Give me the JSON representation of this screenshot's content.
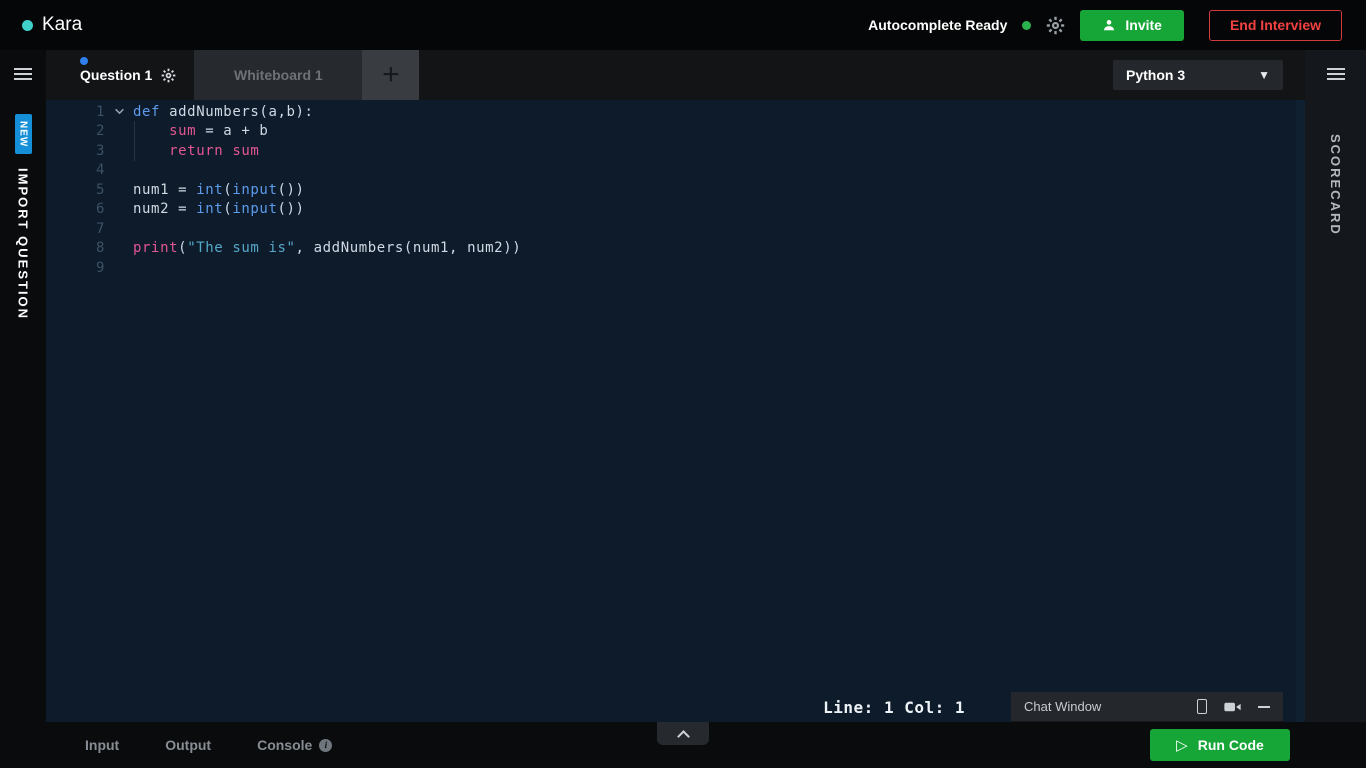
{
  "topbar": {
    "logo": "Kara",
    "autocomplete_status": "Autocomplete Ready",
    "invite_label": "Invite",
    "end_interview_label": "End Interview"
  },
  "left_rail": {
    "new_badge": "NEW",
    "import_question_label": "IMPORT QUESTION"
  },
  "right_rail": {
    "scorecard_label": "SCORECARD"
  },
  "tabbar": {
    "question_tab_label": "Question 1",
    "whiteboard_tab_label": "Whiteboard 1",
    "add_tab_label": "+",
    "language_selected": "Python 3"
  },
  "editor": {
    "status_line": "Line: 1 Col: 1",
    "code_lines": [
      {
        "num": "1",
        "fold": true,
        "tokens": [
          [
            "k",
            "def"
          ],
          [
            "t",
            " addNumbers(a,b):"
          ]
        ]
      },
      {
        "num": "2",
        "guide": true,
        "tokens": [
          [
            "t",
            "    "
          ],
          [
            "p",
            "sum"
          ],
          [
            "t",
            " = a + b"
          ]
        ]
      },
      {
        "num": "3",
        "guide": true,
        "tokens": [
          [
            "t",
            "    "
          ],
          [
            "p",
            "return"
          ],
          [
            "t",
            " "
          ],
          [
            "p",
            "sum"
          ]
        ]
      },
      {
        "num": "4",
        "tokens": []
      },
      {
        "num": "5",
        "tokens": [
          [
            "t",
            "num1 = "
          ],
          [
            "k",
            "int"
          ],
          [
            "t",
            "("
          ],
          [
            "k",
            "input"
          ],
          [
            "t",
            "())"
          ]
        ]
      },
      {
        "num": "6",
        "tokens": [
          [
            "t",
            "num2 = "
          ],
          [
            "k",
            "int"
          ],
          [
            "t",
            "("
          ],
          [
            "k",
            "input"
          ],
          [
            "t",
            "())"
          ]
        ]
      },
      {
        "num": "7",
        "tokens": []
      },
      {
        "num": "8",
        "tokens": [
          [
            "p",
            "print"
          ],
          [
            "t",
            "("
          ],
          [
            "s",
            "\"The sum is\""
          ],
          [
            "t",
            ", addNumbers(num1, num2))"
          ]
        ]
      },
      {
        "num": "9",
        "tokens": []
      }
    ]
  },
  "chat": {
    "title": "Chat Window"
  },
  "bottombar": {
    "input_label": "Input",
    "output_label": "Output",
    "console_label": "Console",
    "run_code_label": "Run Code"
  },
  "colors": {
    "brand_teal": "#3fd0c9",
    "action_green": "#16a637",
    "danger_red": "#e03131",
    "badge_blue": "#1590d8",
    "unsaved_dot_blue": "#2f80ed",
    "editor_background": "#0d1b2a",
    "keyword_blue": "#5d9cec",
    "keyword_pink": "#e25692",
    "string_teal": "#56a8c9"
  }
}
